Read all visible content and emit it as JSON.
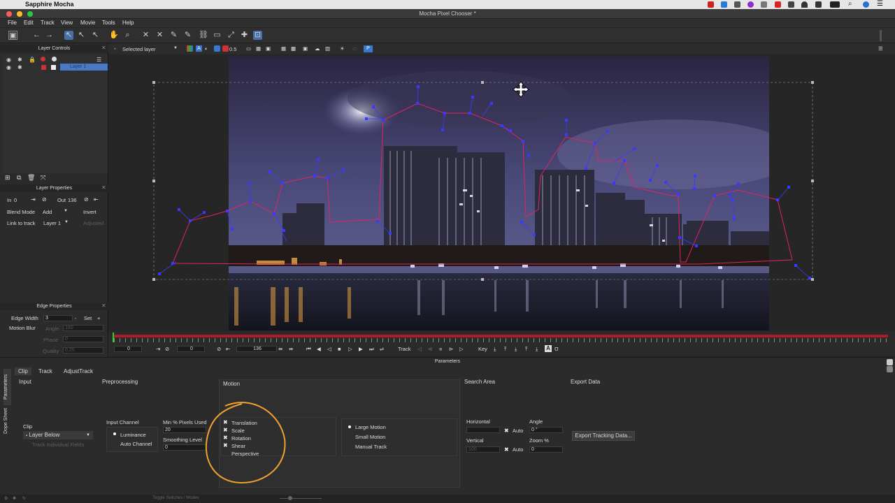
{
  "os": {
    "app_name": "Sapphire Mocha"
  },
  "window": {
    "title": "Mocha Pixel Chooser *"
  },
  "menu": [
    "File",
    "Edit",
    "Track",
    "View",
    "Movie",
    "Tools",
    "Help"
  ],
  "viewer": {
    "layer_select": "Selected layer",
    "opacity": "0.5",
    "p_button": "P"
  },
  "layer_controls": {
    "title": "Layer Controls",
    "layer_name": "Layer 1"
  },
  "layer_properties": {
    "title": "Layer Properties",
    "in_label": "In",
    "in_value": "0",
    "out_label": "Out",
    "out_value": "136",
    "blend_label": "Blend Mode",
    "blend_value": "Add",
    "invert_label": "Invert",
    "link_label": "Link to track",
    "link_value": "Layer 1",
    "adjusted_label": "Adjusted"
  },
  "edge_properties": {
    "title": "Edge Properties",
    "edge_width_label": "Edge Width",
    "edge_width_value": "3",
    "set_label": "Set",
    "motion_blur_label": "Motion Blur",
    "angle_label": "Angle",
    "angle_value": "180",
    "phase_label": "Phase",
    "phase_value": "0",
    "quality_label": "Quality",
    "quality_value": "0.25"
  },
  "timeline": {
    "start": "0",
    "in": "0",
    "out": "136",
    "track_label": "Track",
    "key_label": "Key"
  },
  "parameters": {
    "title": "Parameters",
    "side_tabs": [
      "Parameters",
      "Dope Sheet"
    ],
    "tabs": [
      "Clip",
      "Track",
      "AdjustTrack"
    ],
    "input": {
      "title": "Input",
      "clip_label": "Clip",
      "clip_value": "Layer Below",
      "track_individual": "Track Individual Fields"
    },
    "preprocessing": {
      "title": "Preprocessing",
      "input_channel_label": "Input Channel",
      "luminance": "Luminance",
      "auto_channel": "Auto Channel",
      "min_pixels_label": "Min % Pixels Used",
      "min_pixels_value": "20",
      "smoothing_label": "Smoothing Level",
      "smoothing_value": "0"
    },
    "motion": {
      "title": "Motion",
      "options": [
        {
          "label": "Translation",
          "checked": true
        },
        {
          "label": "Scale",
          "checked": true
        },
        {
          "label": "Rotation",
          "checked": true
        },
        {
          "label": "Shear",
          "checked": true
        },
        {
          "label": "Perspective",
          "checked": false
        }
      ],
      "modes": [
        {
          "label": "Large Motion",
          "selected": true
        },
        {
          "label": "Small Motion",
          "selected": false
        },
        {
          "label": "Manual Track",
          "selected": false
        }
      ]
    },
    "search_area": {
      "title": "Search Area",
      "horizontal_label": "Horizontal",
      "vertical_label": "Vertical",
      "auto_label": "Auto",
      "vertical_value": "100",
      "angle_label": "Angle",
      "angle_value": "0 °",
      "zoom_label": "Zoom %",
      "zoom_value": "0"
    },
    "export": {
      "title": "Export Data",
      "button": "Export Tracking Data..."
    }
  },
  "status_bar": {
    "toggle_label": "Toggle Switches / Modes"
  },
  "colors": {
    "spline_red": "#e0245e",
    "spline_blue": "#3a3aff",
    "annotation_orange": "#f0a030",
    "select_blue": "#4a6fa8"
  }
}
